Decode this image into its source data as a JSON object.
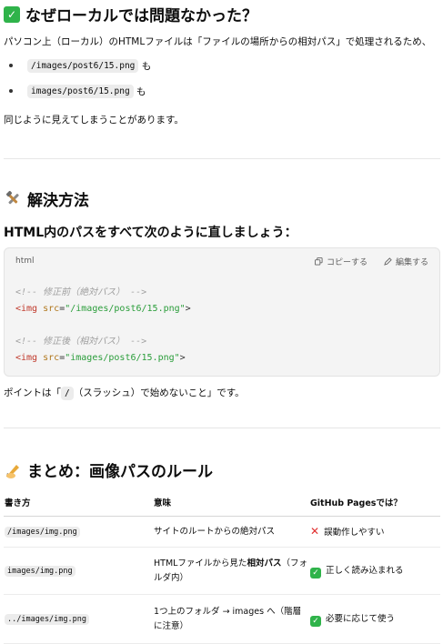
{
  "section1": {
    "heading": "なぜローカルでは問題なかった？",
    "intro": "パソコン上（ローカル）のHTMLファイルは「ファイルの場所からの相対パス」で処理されるため、",
    "bullets": [
      {
        "code": "/images/post6/15.png",
        "suffix": "も"
      },
      {
        "code": "images/post6/15.png",
        "suffix": "も"
      }
    ],
    "outro": "同じように見えてしまうことがあります。"
  },
  "section2": {
    "heading": "解決方法",
    "subheading": "HTML内のパスをすべて次のように直しましょう：",
    "code": {
      "lang": "html",
      "copy_label": "コピーする",
      "edit_label": "編集する",
      "comment1": "<!-- 修正前（絶対パス） -->",
      "comment2": "<!-- 修正後（相対パス） -->",
      "tag_open": "<img",
      "attr": "src",
      "eq": "=",
      "value1": "\"/images/post6/15.png\"",
      "value2": "\"images/post6/15.png\"",
      "tag_close": ">"
    },
    "point_prefix": "ポイントは「",
    "point_code": "/",
    "point_suffix": "（スラッシュ）で始めないこと」です。"
  },
  "section3": {
    "heading": "まとめ：画像パスのルール",
    "columns": [
      "書き方",
      "意味",
      "GitHub Pagesでは？"
    ],
    "rows": [
      {
        "code": "/images/img.png",
        "meaning": "サイトのルートからの絶対パス",
        "status_icon": "x-icon",
        "status": "誤動作しやすい"
      },
      {
        "code": "images/img.png",
        "meaning_a": "HTMLファイルから見た",
        "meaning_b": "相対パス",
        "meaning_c": "（フォルダ内）",
        "status_icon": "check-icon",
        "status": "正しく読み込まれる"
      },
      {
        "code": "../images/img.png",
        "meaning": "1つ上のフォルダ → images へ（階層に注意）",
        "status_icon": "check-icon",
        "status": "必要に応じて使う"
      }
    ]
  },
  "colors": {
    "check_green": "#2fb34a",
    "x_red": "#e03131"
  }
}
